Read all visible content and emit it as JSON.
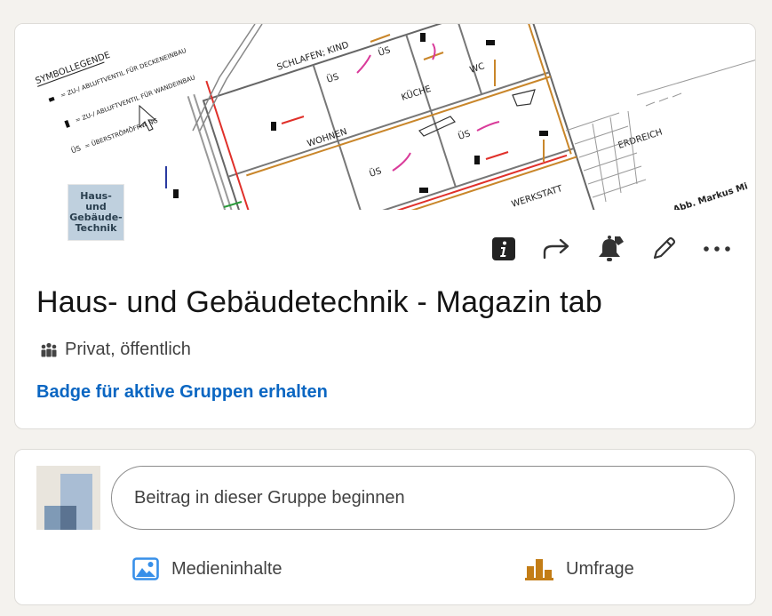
{
  "group": {
    "cover": {
      "legend_title": "SYMBOLLEGENDE",
      "legend_items": [
        "= ZU-/ ABLUFTVENTIL FÜR DECKENEINBAU",
        "= ZU-/ ABLUFTVENTIL FÜR WANDEINBAU",
        "= ÜBERSTRÖMÖFFNUNG"
      ],
      "legend_us": "ÜS",
      "rooms": [
        "SCHLAFEN; KIND",
        "WOHNEN",
        "KÜCHE",
        "WC",
        "WERKSTATT",
        "ERDREICH"
      ],
      "us_labels": [
        "ÜS",
        "ÜS",
        "ÜS",
        "ÜS"
      ],
      "credit": "Abb. Markus Mi"
    },
    "logo_text": [
      "Haus-",
      "und",
      "Gebäude-",
      "Technik"
    ],
    "title": "Haus- und Gebäudetechnik - Magazin tab",
    "visibility": "Privat, öffentlich",
    "badge_link": "Badge für aktive Gruppen erhalten",
    "action_icons": [
      "info-icon",
      "share-icon",
      "bell-icon",
      "pencil-icon",
      "more-icon"
    ]
  },
  "composer": {
    "placeholder": "Beitrag in dieser Gruppe beginnen",
    "media_label": "Medieninhalte",
    "poll_label": "Umfrage"
  },
  "colors": {
    "link": "#0a66c2",
    "media_icon": "#378fe9",
    "poll_icon": "#c37d16",
    "background": "#f4f2ee"
  }
}
